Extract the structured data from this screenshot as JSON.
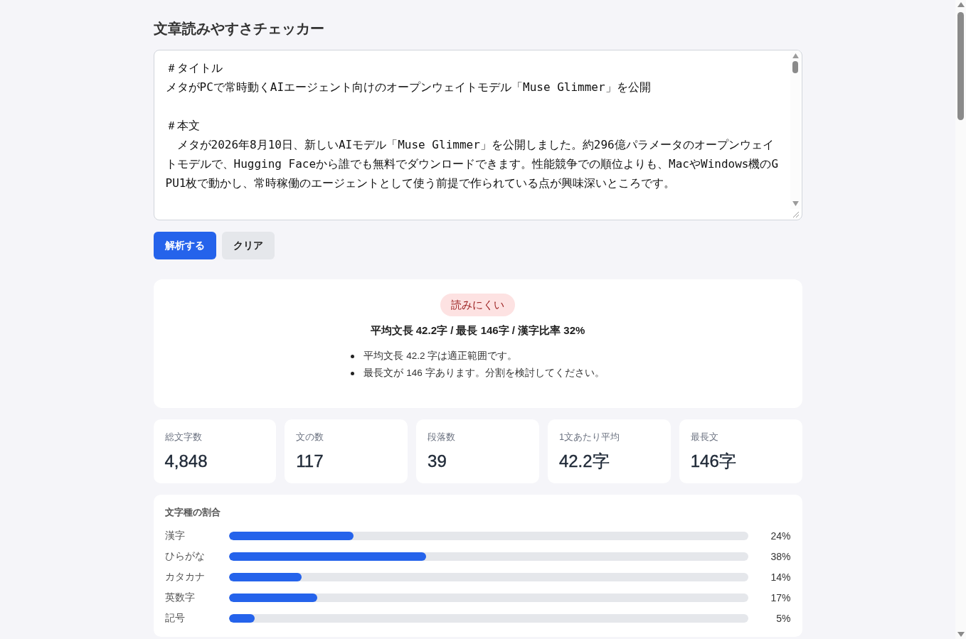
{
  "title": "文章読みやすさチェッカー",
  "editor": {
    "blocks": [
      [
        "＃タイトル",
        "メタがPCで常時動くAIエージェント向けのオープンウェイトモデル「Muse Glimmer」を公開"
      ],
      [
        "＃本文",
        "　メタが2026年8月10日、新しいAIモデル「Muse Glimmer」を公開しました。約296億パラメータのオープンウェイトモデルで、Hugging Faceから誰でも無料でダウンロードできます。性能競争での順位よりも、MacやWindows機のGPU1枚で動かし、常時稼働のエージェントとして使う前提で作られている点が興味深いところです。"
      ]
    ]
  },
  "buttons": [
    {
      "label": "解析する",
      "kind": "primary"
    },
    {
      "label": "クリア",
      "kind": "secondary"
    }
  ],
  "result": {
    "badge": "読みにくい",
    "summary": "平均文長 42.2字 / 最長 146字 / 漢字比率 32%",
    "notes": [
      "平均文長 42.2 字は適正範囲です。",
      "最長文が 146 字あります。分割を検討してください。"
    ]
  },
  "stats": [
    {
      "label": "総文字数",
      "value": "4,848"
    },
    {
      "label": "文の数",
      "value": "117"
    },
    {
      "label": "段落数",
      "value": "39"
    },
    {
      "label": "1文あたり平均",
      "value": "42.2字"
    },
    {
      "label": "最長文",
      "value": "146字"
    }
  ],
  "char_types": {
    "title": "文字種の割合",
    "rows": [
      {
        "label": "漢字",
        "level": 0.24,
        "reading": "24%"
      },
      {
        "label": "ひらがな",
        "level": 0.38,
        "reading": "38%"
      },
      {
        "label": "カタカナ",
        "level": 0.14,
        "reading": "14%"
      },
      {
        "label": "英数字",
        "level": 0.17,
        "reading": "17%"
      },
      {
        "label": "記号",
        "level": 0.05,
        "reading": "5%"
      }
    ]
  }
}
